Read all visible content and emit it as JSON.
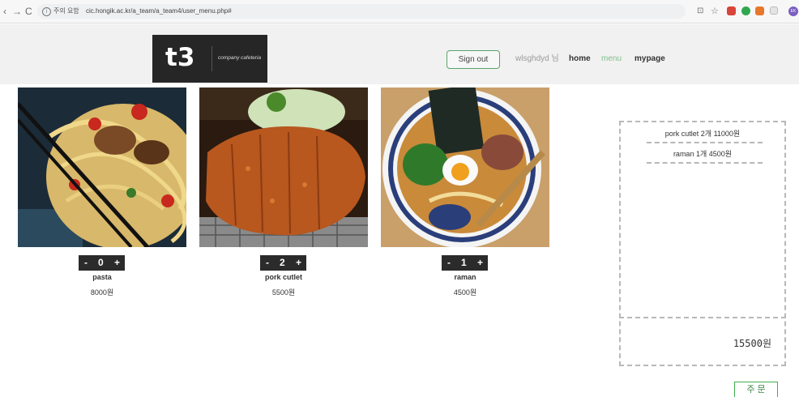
{
  "browser": {
    "back_label": "‹",
    "forward_label": "→",
    "reload_label": "C",
    "security_label": "주의 요함",
    "url": "cic.hongik.ac.kr/a_team/a_team4/user_menu.php#",
    "profile_initials": "EK",
    "info_glyph": "i",
    "star_glyph": "☆",
    "translate_glyph": "⊡"
  },
  "header": {
    "logo_text": "t3",
    "logo_subtitle": "company cafeteria",
    "signout_label": "Sign out",
    "nav": [
      {
        "label": "wlsghdyd 님",
        "color": "#9a9a9a"
      },
      {
        "label": "home",
        "color": "#333333"
      },
      {
        "label": "menu",
        "color": "#7fbf8a"
      },
      {
        "label": "mypage",
        "color": "#333333"
      }
    ]
  },
  "menu": [
    {
      "name": "pasta",
      "price": "8000원",
      "qty": "0"
    },
    {
      "name": "pork cutlet",
      "price": "5500원",
      "qty": "2"
    },
    {
      "name": "raman",
      "price": "4500원",
      "qty": "1"
    }
  ],
  "counter": {
    "minus": "-",
    "plus": "+"
  },
  "cart": {
    "items": [
      "pork cutlet 2개 11000원",
      "raman 1개 4500원"
    ],
    "total": "15500원"
  },
  "order_label": "주 문",
  "colors": {
    "accent_green": "#3fae4d",
    "logo_bg": "#262626",
    "counter_bg": "#2b2b2b"
  }
}
